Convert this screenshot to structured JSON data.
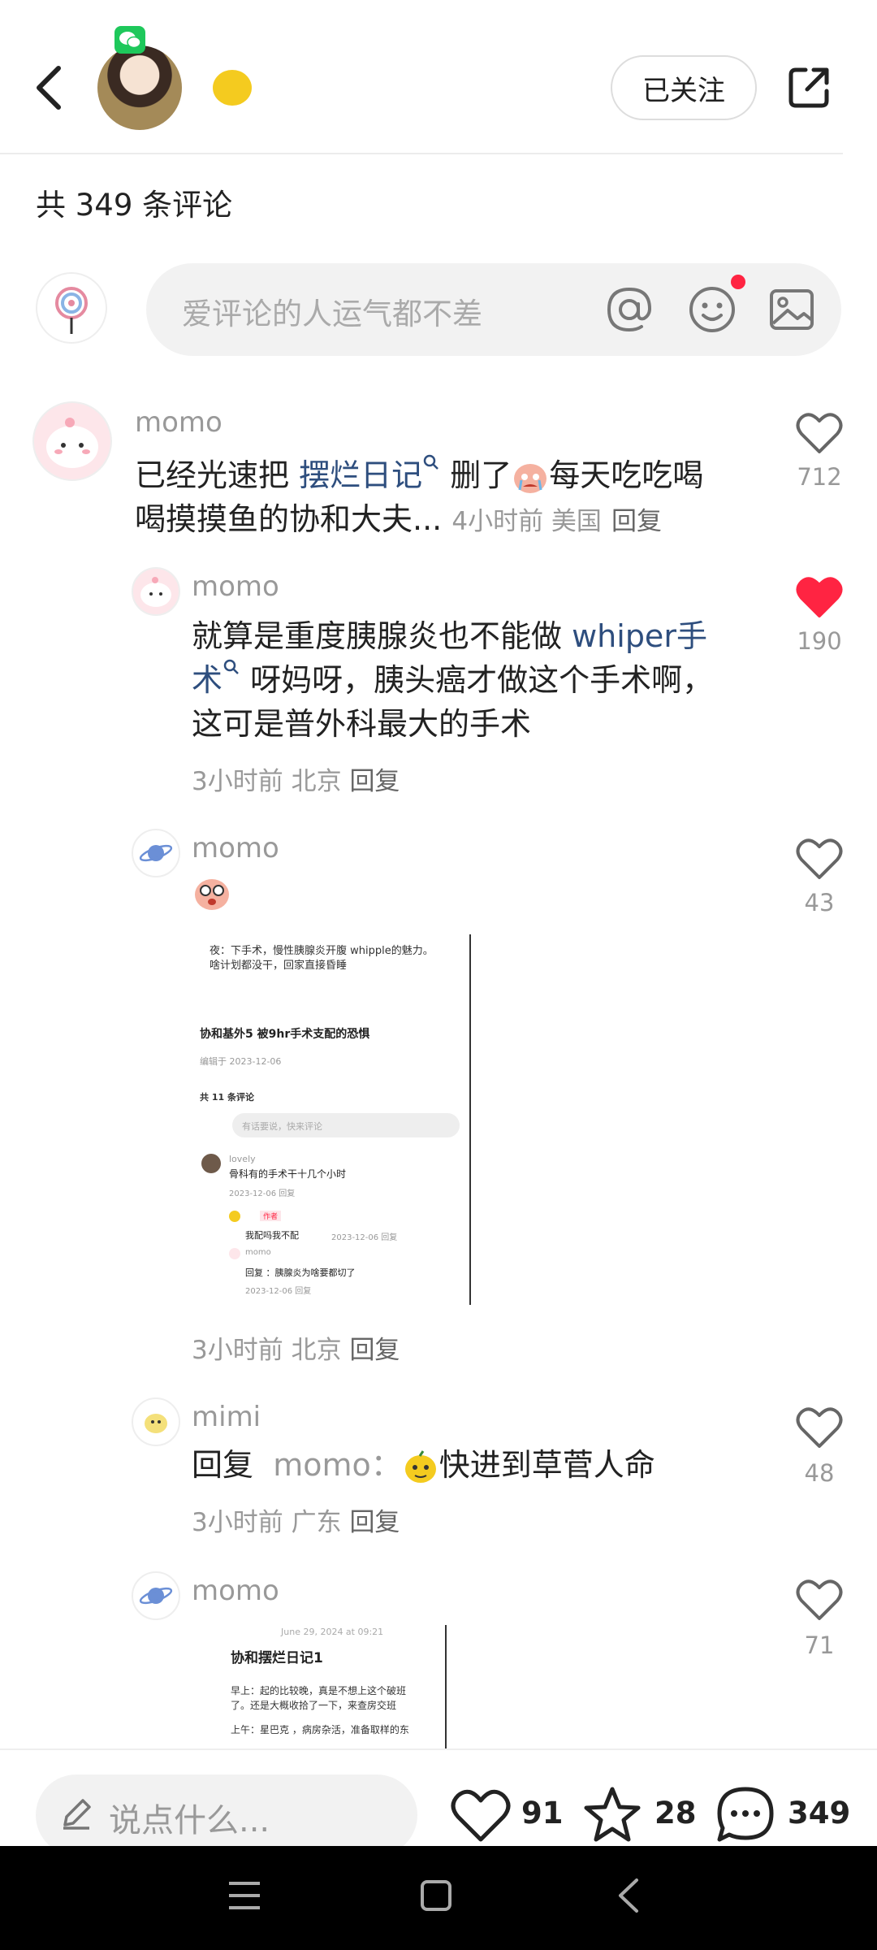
{
  "header": {
    "follow_label": "已关注",
    "comment_count_label": "共 349 条评论"
  },
  "comment_input": {
    "placeholder": "爱评论的人运气都不差"
  },
  "comments": [
    {
      "user": "momo",
      "text_before": "已经光速把 ",
      "link": "摆烂日记",
      "text_after": " 删了",
      "text_line2": "每天吃吃喝",
      "text_line3": "喝摸摸鱼的协和大夫...",
      "meta": "4小时前 美国",
      "reply": "回复",
      "likes": "712",
      "liked": false
    },
    {
      "user": "momo",
      "line1": "就算是重度胰腺炎也不能做 ",
      "link1": "whiper手",
      "link2": "术",
      "line2": " 呀妈呀，胰头癌才做这个手术啊，",
      "line3": "这可是普外科最大的手术",
      "meta": "3小时前 北京",
      "reply": "回复",
      "likes": "190",
      "liked": true
    },
    {
      "user": "momo",
      "meta": "3小时前 北京",
      "reply": "回复",
      "likes": "43",
      "liked": false,
      "screenshot": {
        "line1": "夜：下手术，慢性胰腺炎开腹 whipple的魅力。",
        "line2": "啥计划都没干，回家直接昏睡",
        "title": "协和基外5 被9hr手术支配的恐惧",
        "edited": "编辑于 2023-12-06",
        "count": "共 11 条评论",
        "input_ph": "有话要说，快来评论",
        "c1_user": "lovely",
        "c1_text": "骨科有的手术干十几个小时",
        "c1_meta": "2023-12-06  回复",
        "c2_tag": "作者",
        "c2_text": "我配吗我不配",
        "c2_meta": "2023-12-06  回复",
        "c3_user": "momo",
        "c3_text": "回复      ：胰腺炎为啥要都切了",
        "c3_meta": "2023-12-06  回复"
      }
    },
    {
      "user": "mimi",
      "reply_prefix": "回复",
      "reply_to": "momo：",
      "text": "快进到草菅人命",
      "meta": "3小时前 广东",
      "reply": "回复",
      "likes": "48",
      "liked": false
    },
    {
      "user": "momo",
      "likes": "71",
      "liked": false,
      "screenshot": {
        "date": "June 29, 2024 at 09:21",
        "title": "协和摆烂日记1",
        "line1": "早上：起的比较晚，真是不想上这个破班",
        "line2": "了。还是大概收拾了一下，来查房交班",
        "line3": "上午：星巴克  ，病房杂活，准备取样的东"
      }
    }
  ],
  "bottom_bar": {
    "say_placeholder": "说点什么...",
    "likes": "91",
    "stars": "28",
    "comments": "349"
  },
  "colors": {
    "liked_red": "#ff2442",
    "link_blue": "#2e4e7e",
    "wechat_green": "#1ec85b"
  }
}
